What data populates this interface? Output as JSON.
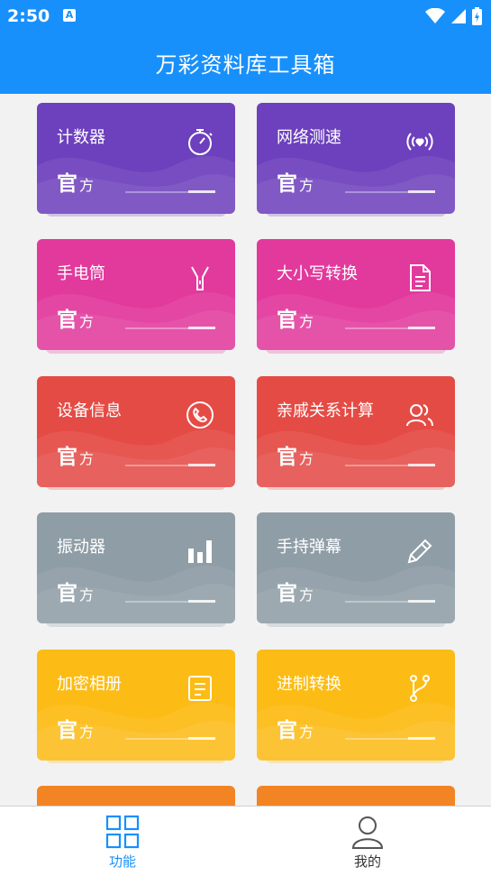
{
  "status_bar": {
    "time": "2:50",
    "left_icon": "A"
  },
  "app": {
    "title": "万彩资料库工具箱"
  },
  "colors": {
    "primary": "#1890fb",
    "purple": "#6d40bd",
    "pink": "#e2399c",
    "red": "#e54b45",
    "gray": "#8f9da6",
    "yellow": "#fcbc15",
    "orange": "#f28424"
  },
  "cards": [
    {
      "title": "计数器",
      "sub_big": "官",
      "sub_small": "方",
      "icon": "stopwatch-icon"
    },
    {
      "title": "网络测速",
      "sub_big": "官",
      "sub_small": "方",
      "icon": "signal-heart-icon"
    },
    {
      "title": "手电筒",
      "sub_big": "官",
      "sub_small": "方",
      "icon": "flashlight-icon"
    },
    {
      "title": "大小写转换",
      "sub_big": "官",
      "sub_small": "方",
      "icon": "document-icon"
    },
    {
      "title": "设备信息",
      "sub_big": "官",
      "sub_small": "方",
      "icon": "phone-icon"
    },
    {
      "title": "亲戚关系计算",
      "sub_big": "官",
      "sub_small": "方",
      "icon": "people-icon"
    },
    {
      "title": "振动器",
      "sub_big": "官",
      "sub_small": "方",
      "icon": "bar-chart-icon"
    },
    {
      "title": "手持弹幕",
      "sub_big": "官",
      "sub_small": "方",
      "icon": "pencil-icon"
    },
    {
      "title": "加密相册",
      "sub_big": "官",
      "sub_small": "方",
      "icon": "note-icon"
    },
    {
      "title": "进制转换",
      "sub_big": "官",
      "sub_small": "方",
      "icon": "branch-icon"
    }
  ],
  "bottom_nav": [
    {
      "label": "功能",
      "icon": "grid-icon",
      "active": true
    },
    {
      "label": "我的",
      "icon": "user-icon",
      "active": false
    }
  ]
}
